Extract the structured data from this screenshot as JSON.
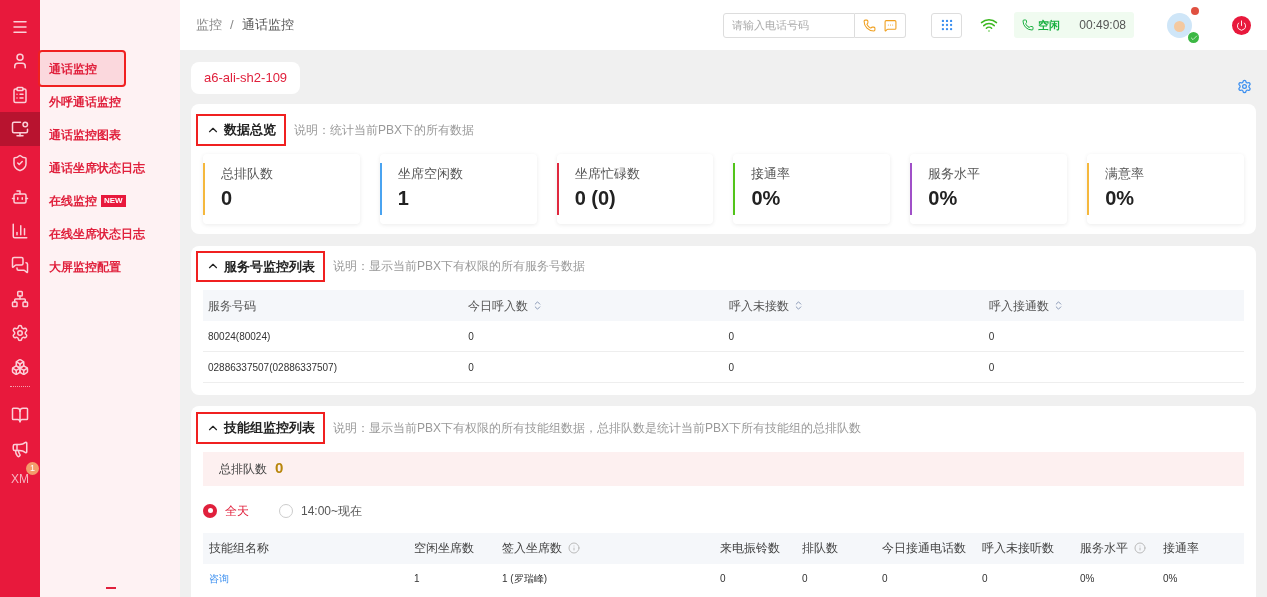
{
  "rail": {
    "items": [
      {
        "selected": false
      },
      {
        "selected": false
      },
      {
        "selected": false
      },
      {
        "selected": true
      },
      {
        "selected": false
      },
      {
        "selected": false
      },
      {
        "selected": false
      },
      {
        "selected": false
      },
      {
        "selected": false
      },
      {
        "selected": false
      },
      {
        "selected": false
      },
      {
        "selected": false
      },
      {
        "selected": false
      }
    ],
    "account": {
      "label": "XM",
      "badge": "1"
    }
  },
  "submenu": {
    "items": [
      {
        "label": "通话监控",
        "selected": true,
        "highlighted": true
      },
      {
        "label": "外呼通话监控",
        "selected": false,
        "highlighted": false
      },
      {
        "label": "通话监控图表",
        "selected": false,
        "highlighted": false
      },
      {
        "label": "通话坐席状态日志",
        "selected": false,
        "highlighted": false
      },
      {
        "label": "在线监控",
        "selected": false,
        "highlighted": false,
        "badge": "NEW"
      },
      {
        "label": "在线坐席状态日志",
        "selected": false,
        "highlighted": false
      },
      {
        "label": "大屏监控配置",
        "selected": false,
        "highlighted": false
      }
    ]
  },
  "topbar": {
    "breadcrumb": [
      "监控",
      "通话监控"
    ],
    "breadcrumb_separator": "/",
    "phone_field": {
      "placeholder": "请输入电话号码"
    },
    "status": "空闲",
    "timer": "00:49:08",
    "avatar": {
      "notification": true,
      "online": true
    }
  },
  "server_tab": {
    "label": "a6-ali-sh2-109",
    "selected": true
  },
  "overview": {
    "title": "数据总览",
    "highlighted": true,
    "expanded": true,
    "note": "说明：统计当前PBX下的所有数据",
    "stats": [
      {
        "label": "总排队数",
        "value": "0",
        "color": "#f5b83d"
      },
      {
        "label": "坐席空闲数",
        "value": "1",
        "color": "#4aa3f0"
      },
      {
        "label": "坐席忙碌数",
        "value": "0 (0)",
        "color": "#e0283e"
      },
      {
        "label": "接通率",
        "value": "0%",
        "color": "#52c41a"
      },
      {
        "label": "服务水平",
        "value": "0%",
        "color": "#a050c8"
      },
      {
        "label": "满意率",
        "value": "0%",
        "color": "#f5b83d"
      }
    ]
  },
  "service_numbers": {
    "title": "服务号监控列表",
    "highlighted": true,
    "expanded": true,
    "note": "说明：显示当前PBX下有权限的所有服务号数据",
    "table": {
      "columns": [
        {
          "label": "服务号码",
          "sortable": false
        },
        {
          "label": "今日呼入数",
          "sortable": true
        },
        {
          "label": "呼入未接数",
          "sortable": true
        },
        {
          "label": "呼入接通数",
          "sortable": true
        }
      ],
      "rows": [
        [
          "80024(80024)",
          "0",
          "0",
          "0"
        ],
        [
          "02886337507(02886337507)",
          "0",
          "0",
          "0"
        ]
      ]
    }
  },
  "skill_groups": {
    "title": "技能组监控列表",
    "highlighted": true,
    "expanded": true,
    "note": "说明：显示当前PBX下有权限的所有技能组数据，总排队数是统计当前PBX下所有技能组的总排队数",
    "total_label": "总排队数",
    "total_value": "0",
    "time_range": [
      {
        "label": "全天",
        "selected": true
      },
      {
        "label": "14:00~现在",
        "selected": false
      }
    ],
    "table": {
      "columns": [
        {
          "label": "技能组名称",
          "info": false
        },
        {
          "label": "空闲坐席数",
          "info": false
        },
        {
          "label": "签入坐席数",
          "info": true
        },
        {
          "label": "来电振铃数",
          "info": false
        },
        {
          "label": "排队数",
          "info": false
        },
        {
          "label": "今日接通电话数",
          "info": false
        },
        {
          "label": "呼入未接听数",
          "info": false
        },
        {
          "label": "服务水平",
          "info": true
        },
        {
          "label": "接通率",
          "info": false
        }
      ],
      "rows": [
        [
          {
            "text": "咨询",
            "kind": "link"
          },
          {
            "text": "1",
            "kind": "text"
          },
          {
            "text": "1 (罗瑞峰)",
            "kind": "text"
          },
          {
            "text": "0",
            "kind": "text"
          },
          {
            "text": "0",
            "kind": "text"
          },
          {
            "text": "0",
            "kind": "text"
          },
          {
            "text": "0",
            "kind": "text"
          },
          {
            "text": "0%",
            "kind": "text"
          },
          {
            "text": "0%",
            "kind": "text"
          }
        ]
      ]
    }
  }
}
